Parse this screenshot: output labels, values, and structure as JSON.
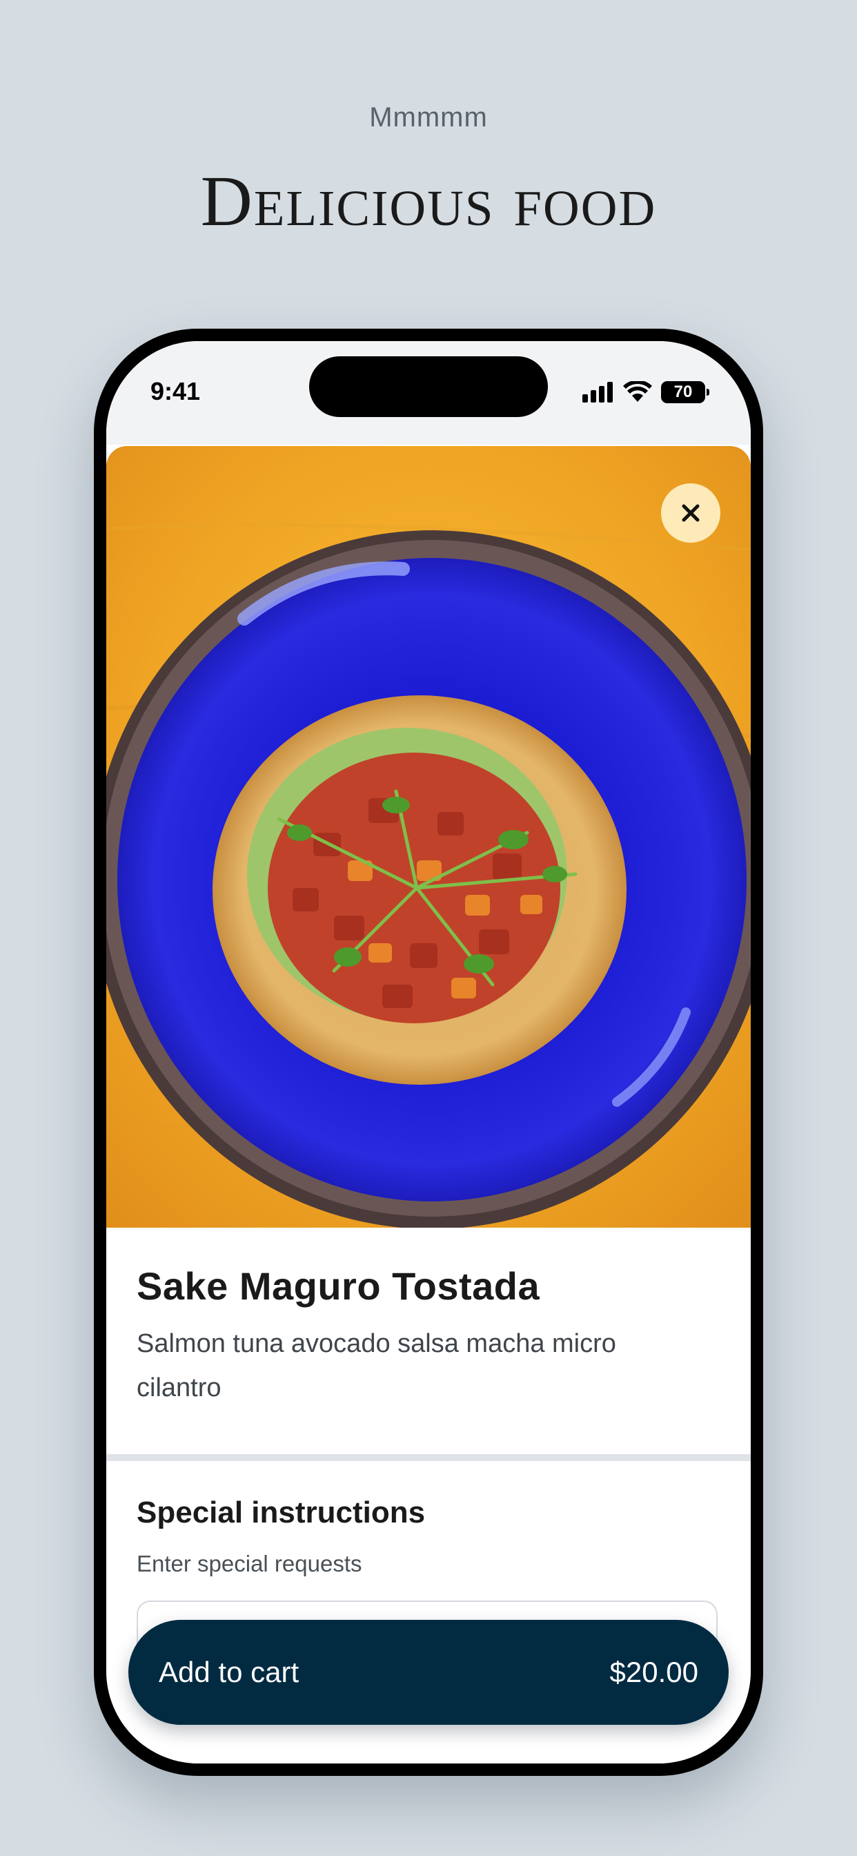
{
  "header": {
    "eyebrow": "Mmmmm",
    "title": "Delicious food"
  },
  "status_bar": {
    "time": "9:41",
    "battery": "70",
    "icons": [
      "signal-icon",
      "wifi-icon",
      "battery-icon"
    ]
  },
  "item": {
    "image_icon": "food-photo",
    "close_icon": "close-icon",
    "name": "Sake Maguro Tostada",
    "description": "Salmon tuna avocado salsa macha micro cilantro"
  },
  "special_instructions": {
    "title": "Special instructions",
    "subtitle": "Enter special requests",
    "value": ""
  },
  "cart": {
    "label": "Add to cart",
    "price": "$20.00"
  },
  "colors": {
    "background": "#d5dce2",
    "cart_button": "#022b42",
    "plate": "#1f1fd0",
    "table": "#f2a928"
  }
}
